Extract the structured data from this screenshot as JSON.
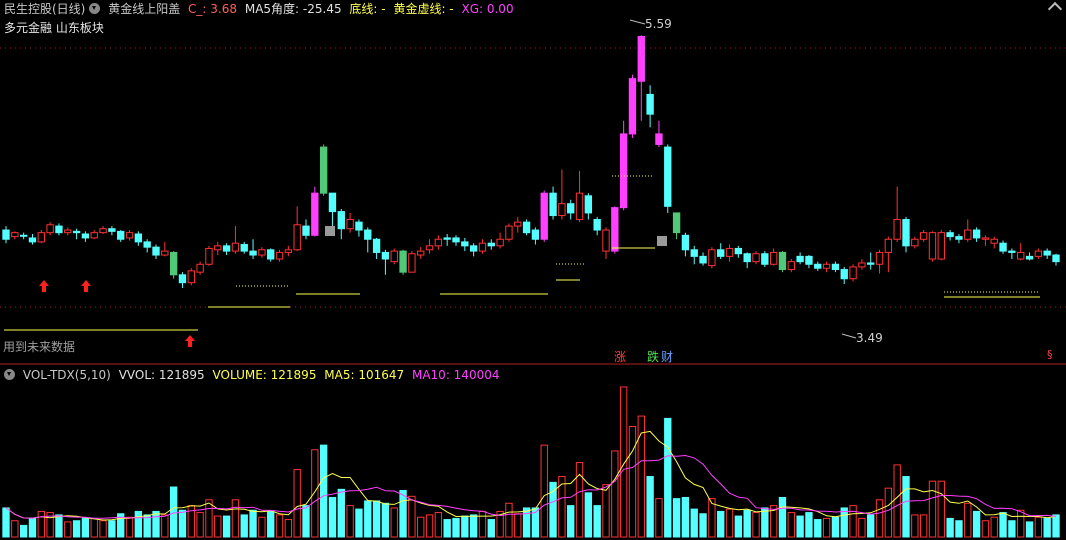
{
  "header": {
    "stock_name": "民生控股(日线)",
    "indicator_name": "黄金线上阳盖",
    "c_label": "C_: 3.68",
    "ma5_label": "MA5角度: -25.45",
    "bottom_line_label": "底线: -",
    "gold_dash_label": "黄金虚线: -",
    "xg_label": "XG: 0.00"
  },
  "sectors": "多元金融  山东板块",
  "future_data_note": "用到未来数据",
  "price_markers": {
    "high": "5.59",
    "low": "3.49"
  },
  "signal_tags": {
    "rise": "涨",
    "fall": "跌",
    "wealth": "财"
  },
  "vol_header": {
    "name": "VOL-TDX(5,10)",
    "vvol": "VVOL: 121895",
    "volume": "VOLUME: 121895",
    "ma5": "MA5: 101647",
    "ma10": "MA10: 140004"
  },
  "colors": {
    "up": "#ff3232",
    "down": "#54ffff",
    "magenta": "#ff40ff",
    "green": "#50c878",
    "gold": "#ffff50",
    "gray": "#a0a0a0",
    "label_gold": "#ffff50",
    "label_magenta": "#ff40ff",
    "label_orange": "#ff6060"
  },
  "chart_data": {
    "type": "candlestick",
    "price_range": [
      3.3,
      5.7
    ],
    "candles": [
      [
        4.05,
        4.12,
        4.15,
        4.02,
        "d"
      ],
      [
        4.07,
        4.1,
        4.11,
        4.05,
        "u"
      ],
      [
        4.08,
        4.08,
        4.1,
        4.05,
        "d"
      ],
      [
        4.06,
        4.03,
        4.09,
        4.01,
        "d"
      ],
      [
        4.03,
        4.1,
        4.12,
        4.02,
        "u"
      ],
      [
        4.1,
        4.16,
        4.18,
        4.08,
        "u"
      ],
      [
        4.15,
        4.1,
        4.17,
        4.08,
        "d"
      ],
      [
        4.1,
        4.12,
        4.14,
        4.08,
        "u"
      ],
      [
        4.11,
        4.1,
        4.13,
        4.05,
        "d"
      ],
      [
        4.09,
        4.06,
        4.11,
        4.03,
        "d"
      ],
      [
        4.06,
        4.1,
        4.12,
        4.05,
        "u"
      ],
      [
        4.1,
        4.13,
        4.15,
        4.09,
        "u"
      ],
      [
        4.13,
        4.11,
        4.15,
        4.08,
        "d"
      ],
      [
        4.11,
        4.05,
        4.12,
        4.03,
        "d"
      ],
      [
        4.06,
        4.1,
        4.12,
        4.04,
        "u"
      ],
      [
        4.09,
        4.03,
        4.11,
        4.0,
        "d"
      ],
      [
        4.03,
        3.99,
        4.05,
        3.95,
        "d"
      ],
      [
        3.99,
        3.93,
        4.01,
        3.9,
        "d"
      ],
      [
        3.93,
        3.96,
        4.03,
        3.92,
        "u"
      ],
      [
        3.95,
        3.78,
        3.96,
        3.75,
        "g"
      ],
      [
        3.78,
        3.72,
        3.8,
        3.68,
        "d"
      ],
      [
        3.72,
        3.81,
        3.83,
        3.7,
        "u"
      ],
      [
        3.8,
        3.86,
        3.88,
        3.78,
        "u"
      ],
      [
        3.86,
        3.98,
        4.0,
        3.85,
        "u"
      ],
      [
        3.97,
        4.0,
        4.03,
        3.93,
        "u"
      ],
      [
        4.0,
        3.96,
        4.02,
        3.93,
        "d"
      ],
      [
        3.96,
        4.02,
        4.15,
        3.94,
        "u"
      ],
      [
        4.01,
        3.96,
        4.03,
        3.94,
        "d"
      ],
      [
        3.96,
        3.93,
        4.05,
        3.9,
        "d"
      ],
      [
        3.93,
        3.97,
        3.99,
        3.91,
        "u"
      ],
      [
        3.97,
        3.9,
        3.98,
        3.88,
        "d"
      ],
      [
        3.9,
        3.95,
        3.97,
        3.88,
        "u"
      ],
      [
        3.95,
        3.97,
        4.0,
        3.92,
        "u"
      ],
      [
        3.97,
        4.16,
        4.3,
        3.96,
        "u"
      ],
      [
        4.15,
        4.08,
        4.2,
        4.05,
        "d"
      ],
      [
        4.08,
        4.4,
        4.45,
        4.07,
        "m"
      ],
      [
        4.4,
        4.75,
        4.77,
        4.38,
        "g"
      ],
      [
        4.4,
        4.26,
        4.3,
        4.15,
        "d"
      ],
      [
        4.26,
        4.13,
        4.28,
        4.05,
        "d"
      ],
      [
        4.13,
        4.2,
        4.25,
        4.1,
        "u"
      ],
      [
        4.18,
        4.12,
        4.2,
        4.07,
        "d"
      ],
      [
        4.12,
        4.05,
        4.14,
        3.95,
        "d"
      ],
      [
        4.05,
        3.95,
        4.06,
        3.9,
        "d"
      ],
      [
        3.95,
        3.9,
        3.97,
        3.78,
        "d"
      ],
      [
        3.88,
        3.96,
        3.98,
        3.86,
        "u"
      ],
      [
        3.96,
        3.8,
        3.97,
        3.78,
        "g"
      ],
      [
        3.8,
        3.94,
        3.96,
        3.8,
        "u"
      ],
      [
        3.93,
        3.96,
        3.99,
        3.9,
        "u"
      ],
      [
        3.97,
        4.0,
        4.05,
        3.94,
        "u"
      ],
      [
        4.0,
        4.05,
        4.08,
        3.97,
        "u"
      ],
      [
        4.05,
        4.06,
        4.09,
        4.0,
        "d"
      ],
      [
        4.06,
        4.03,
        4.08,
        4.0,
        "d"
      ],
      [
        4.03,
        4.0,
        4.06,
        3.96,
        "d"
      ],
      [
        4.0,
        3.96,
        4.02,
        3.92,
        "d"
      ],
      [
        3.96,
        4.02,
        4.05,
        3.94,
        "u"
      ],
      [
        4.02,
        4.0,
        4.05,
        3.97,
        "d"
      ],
      [
        4.0,
        4.05,
        4.1,
        3.98,
        "u"
      ],
      [
        4.05,
        4.15,
        4.17,
        4.03,
        "u"
      ],
      [
        4.15,
        4.18,
        4.22,
        4.1,
        "u"
      ],
      [
        4.18,
        4.1,
        4.2,
        4.08,
        "d"
      ],
      [
        4.12,
        4.05,
        4.14,
        4.01,
        "d"
      ],
      [
        4.05,
        4.4,
        4.42,
        4.03,
        "m"
      ],
      [
        4.4,
        4.23,
        4.45,
        4.2,
        "d"
      ],
      [
        4.23,
        4.32,
        4.58,
        4.2,
        "u"
      ],
      [
        4.32,
        4.25,
        4.35,
        4.2,
        "d"
      ],
      [
        4.2,
        4.4,
        4.57,
        4.18,
        "u"
      ],
      [
        4.38,
        4.25,
        4.4,
        4.2,
        "d"
      ],
      [
        4.2,
        4.12,
        4.22,
        4.08,
        "d"
      ],
      [
        4.12,
        3.96,
        4.14,
        3.9,
        "u"
      ],
      [
        3.96,
        4.29,
        4.3,
        3.94,
        "m"
      ],
      [
        4.29,
        4.85,
        4.95,
        4.27,
        "m"
      ],
      [
        4.85,
        5.27,
        5.3,
        4.82,
        "m"
      ],
      [
        5.25,
        5.59,
        5.6,
        4.95,
        "m"
      ],
      [
        5.0,
        5.15,
        5.22,
        4.9,
        "d"
      ],
      [
        4.85,
        4.77,
        4.95,
        4.75,
        "m"
      ],
      [
        4.75,
        4.3,
        4.77,
        4.25,
        "d"
      ],
      [
        4.25,
        4.1,
        4.18,
        4.05,
        "g"
      ],
      [
        4.08,
        3.97,
        4.1,
        3.92,
        "d"
      ],
      [
        3.97,
        3.92,
        4.0,
        3.86,
        "d"
      ],
      [
        3.92,
        3.87,
        3.95,
        3.85,
        "d"
      ],
      [
        3.85,
        3.97,
        3.99,
        3.83,
        "u"
      ],
      [
        3.97,
        3.92,
        4.02,
        3.9,
        "d"
      ],
      [
        3.92,
        3.98,
        4.01,
        3.88,
        "u"
      ],
      [
        3.98,
        3.94,
        4.0,
        3.91,
        "d"
      ],
      [
        3.94,
        3.88,
        3.95,
        3.83,
        "d"
      ],
      [
        3.88,
        3.94,
        3.96,
        3.86,
        "u"
      ],
      [
        3.94,
        3.86,
        3.96,
        3.84,
        "d"
      ],
      [
        3.86,
        3.95,
        3.98,
        3.85,
        "u"
      ],
      [
        3.95,
        3.82,
        3.96,
        3.8,
        "g"
      ],
      [
        3.82,
        3.88,
        3.9,
        3.8,
        "u"
      ],
      [
        3.88,
        3.92,
        3.95,
        3.86,
        "d"
      ],
      [
        3.92,
        3.86,
        3.93,
        3.83,
        "d"
      ],
      [
        3.86,
        3.83,
        3.88,
        3.81,
        "d"
      ],
      [
        3.83,
        3.86,
        3.88,
        3.8,
        "u"
      ],
      [
        3.86,
        3.82,
        3.88,
        3.8,
        "d"
      ],
      [
        3.82,
        3.75,
        3.84,
        3.71,
        "d"
      ],
      [
        3.75,
        3.84,
        3.86,
        3.73,
        "u"
      ],
      [
        3.84,
        3.87,
        3.9,
        3.82,
        "u"
      ],
      [
        3.87,
        3.86,
        3.95,
        3.82,
        "d"
      ],
      [
        3.86,
        3.95,
        3.97,
        3.79,
        "u"
      ],
      [
        3.95,
        4.05,
        4.07,
        3.8,
        "u"
      ],
      [
        4.05,
        4.2,
        4.45,
        4.03,
        "u"
      ],
      [
        4.2,
        4.0,
        4.22,
        3.95,
        "d"
      ],
      [
        4.0,
        4.05,
        4.07,
        3.98,
        "u"
      ],
      [
        4.05,
        4.1,
        4.12,
        4.03,
        "u"
      ],
      [
        4.1,
        3.9,
        4.11,
        3.88,
        "u"
      ],
      [
        3.9,
        4.1,
        4.12,
        3.89,
        "u"
      ],
      [
        4.1,
        4.07,
        4.12,
        4.04,
        "d"
      ],
      [
        4.07,
        4.05,
        4.09,
        4.02,
        "d"
      ],
      [
        4.05,
        4.12,
        4.2,
        4.03,
        "u"
      ],
      [
        4.12,
        4.06,
        4.14,
        4.03,
        "d"
      ],
      [
        4.06,
        4.05,
        4.08,
        4.0,
        "u"
      ],
      [
        4.05,
        4.02,
        4.07,
        3.98,
        "u"
      ],
      [
        4.02,
        3.96,
        4.04,
        3.94,
        "d"
      ],
      [
        3.96,
        3.95,
        3.98,
        3.9,
        "d"
      ],
      [
        3.95,
        3.9,
        4.02,
        3.89,
        "u"
      ],
      [
        3.9,
        3.92,
        3.95,
        3.89,
        "d"
      ],
      [
        3.92,
        3.96,
        3.98,
        3.9,
        "u"
      ],
      [
        3.96,
        3.93,
        3.98,
        3.9,
        "d"
      ],
      [
        3.93,
        3.88,
        3.94,
        3.85,
        "d"
      ]
    ],
    "volume_series": [
      {
        "name": "MA5",
        "color": "gold"
      },
      {
        "name": "MA10",
        "color": "magenta"
      }
    ]
  }
}
